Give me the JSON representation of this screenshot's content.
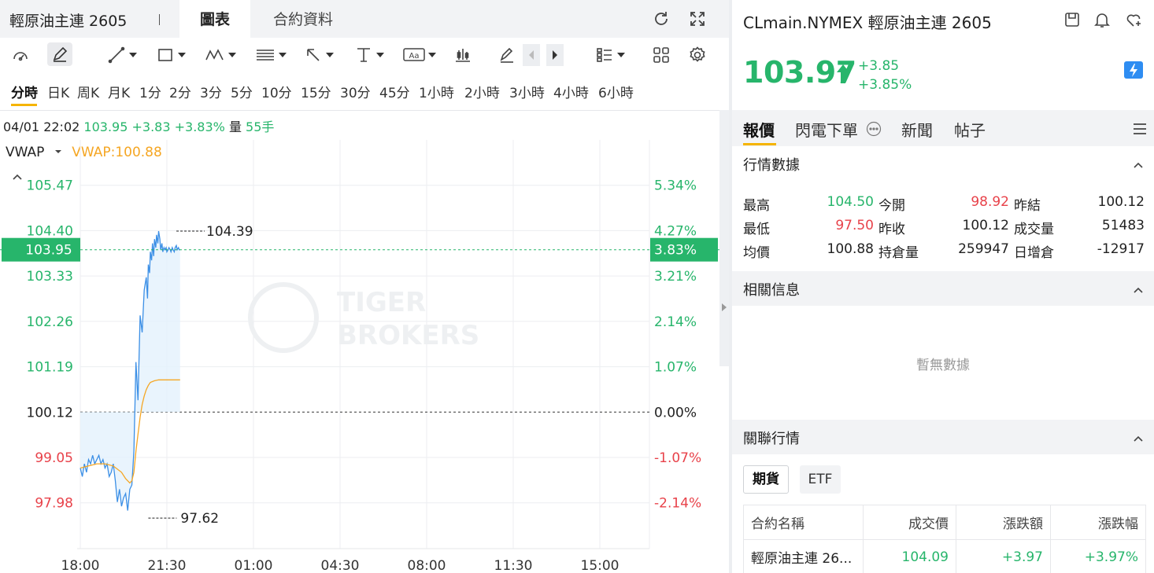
{
  "left": {
    "title": "輕原油主連 2605",
    "tabs": [
      {
        "label": "圖表",
        "active": true
      },
      {
        "label": "合約資料",
        "active": false
      }
    ],
    "title_icons": [
      "refresh-icon",
      "fullscreen-icon"
    ],
    "toolbar_icons": [
      "gauge-icon",
      "pen-edit-icon",
      "trend-line-icon",
      "rectangle-icon",
      "pattern-icon",
      "fibonacci-icon",
      "arrow-tool-icon",
      "text-cursor-icon",
      "text-label-icon",
      "candle-settings-icon",
      "eraser-icon",
      "scroll-left-icon",
      "scroll-right-icon",
      "list-layout-icon",
      "grid-layout-icon",
      "settings-icon"
    ],
    "periods": [
      "分時",
      "日K",
      "周K",
      "月K",
      "1分",
      "2分",
      "3分",
      "5分",
      "10分",
      "15分",
      "30分",
      "45分",
      "1小時",
      "2小時",
      "3小時",
      "4小時",
      "6小時"
    ],
    "active_period": "分時",
    "quote": {
      "datetime": "04/01 22:02",
      "price": "103.95",
      "change": "+3.83",
      "change_pct": "+3.83%",
      "volume_label": "量",
      "volume": "55手"
    },
    "indicator": {
      "name": "VWAP",
      "value_text": "VWAP:100.88"
    },
    "watermark": [
      "TIGER",
      "BROKERS"
    ]
  },
  "chart_data": {
    "type": "line",
    "title": "",
    "x_ticks": [
      "18:00",
      "21:30",
      "01:00",
      "04:30",
      "08:00",
      "11:30",
      "15:00"
    ],
    "y_ticks_left": [
      "105.47",
      "104.40",
      "103.33",
      "102.26",
      "101.19",
      "100.12",
      "99.05",
      "97.98"
    ],
    "y_ticks_right": [
      "5.34%",
      "4.27%",
      "3.21%",
      "2.14%",
      "1.07%",
      "0.00%",
      "-1.07%",
      "-2.14%"
    ],
    "ylim": [
      96.9,
      106.54
    ],
    "prev_close": 100.12,
    "current_price": 103.95,
    "current_price_label": "103.95",
    "current_pct_label": "3.83%",
    "high": {
      "value": 104.39,
      "label": "104.39",
      "time_min": 233
    },
    "low": {
      "value": 97.62,
      "label": "97.62",
      "time_min": 165
    },
    "series": [
      {
        "name": "",
        "color": "#3b8fe6",
        "x_min": [
          0,
          5,
          10,
          15,
          20,
          25,
          30,
          35,
          40,
          45,
          50,
          55,
          60,
          65,
          70,
          75,
          80,
          85,
          90,
          95,
          100,
          105,
          110,
          115,
          120,
          125,
          130,
          135,
          140,
          145,
          150,
          155,
          160,
          163,
          165,
          168,
          170,
          173,
          175,
          178,
          180,
          183,
          185,
          188,
          190,
          193,
          195,
          198,
          200,
          203,
          205,
          208,
          210,
          213,
          215,
          218,
          220,
          223,
          225,
          228,
          230,
          233,
          235,
          238,
          240,
          242
        ],
        "values": [
          98.8,
          98.6,
          98.9,
          98.7,
          99.0,
          98.9,
          99.1,
          98.9,
          99.0,
          99.1,
          98.9,
          99.0,
          98.8,
          98.9,
          98.6,
          98.7,
          98.9,
          98.5,
          98.0,
          98.3,
          97.9,
          98.1,
          98.2,
          97.8,
          98.3,
          98.4,
          99.2,
          101.3,
          100.4,
          102.4,
          102.0,
          103.0,
          103.3,
          102.8,
          103.6,
          103.4,
          103.9,
          103.7,
          104.1,
          103.8,
          104.2,
          104.0,
          104.3,
          104.1,
          104.39,
          104.2,
          103.95,
          104.1,
          103.9,
          104.0,
          103.95,
          104.0,
          103.9,
          103.95,
          104.0,
          103.95,
          103.9,
          104.0,
          103.95,
          103.9,
          104.0,
          104.05,
          103.95,
          104.0,
          103.95,
          103.95
        ]
      },
      {
        "name": "VWAP",
        "color": "#f5a623",
        "x_min": [
          0,
          20,
          40,
          60,
          80,
          100,
          110,
          120,
          125,
          130,
          135,
          140,
          145,
          150,
          155,
          160,
          165,
          170,
          180,
          190,
          200,
          210,
          220,
          230,
          242
        ],
        "values": [
          98.8,
          98.85,
          98.9,
          98.9,
          98.85,
          98.7,
          98.55,
          98.45,
          98.5,
          98.7,
          99.2,
          99.6,
          100.0,
          100.3,
          100.5,
          100.65,
          100.75,
          100.82,
          100.86,
          100.88,
          100.88,
          100.88,
          100.88,
          100.88,
          100.88
        ]
      }
    ]
  },
  "right": {
    "title": "CLmain.NYMEX 輕原油主連 2605",
    "header_icons": [
      "save-icon",
      "bell-icon",
      "heart-add-icon"
    ],
    "price": "103.97",
    "change": "+3.85",
    "change_pct": "+3.85%",
    "badge_icon": "lightning-icon",
    "tabs": [
      {
        "label": "報價",
        "active": true
      },
      {
        "label": "閃電下單",
        "active": false
      },
      {
        "label": "新聞",
        "active": false
      },
      {
        "label": "帖子",
        "active": false
      }
    ],
    "market_data_title": "行情數據",
    "stats": [
      [
        {
          "label": "最高",
          "value": "104.50",
          "color": "#27b56b"
        },
        {
          "label": "今開",
          "value": "98.92",
          "color": "#e8424a"
        },
        {
          "label": "昨結",
          "value": "100.12",
          "color": "#222222"
        }
      ],
      [
        {
          "label": "最低",
          "value": "97.50",
          "color": "#e8424a"
        },
        {
          "label": "昨收",
          "value": "100.12",
          "color": "#222222"
        },
        {
          "label": "成交量",
          "value": "51483",
          "color": "#222222"
        }
      ],
      [
        {
          "label": "均價",
          "value": "100.88",
          "color": "#222222"
        },
        {
          "label": "持倉量",
          "value": "259947",
          "color": "#222222"
        },
        {
          "label": "日增倉",
          "value": "-12917",
          "color": "#222222"
        }
      ]
    ],
    "related_info_title": "相關信息",
    "no_data": "暫無數據",
    "related_quotes_title": "關聯行情",
    "filters": [
      "期貨",
      "ETF"
    ],
    "table": {
      "headers": [
        "合約名稱",
        "成交價",
        "漲跌額",
        "漲跌幅"
      ],
      "rows": [
        [
          "輕原油主連 26...",
          "104.09",
          "+3.97",
          "+3.97%"
        ]
      ]
    }
  }
}
